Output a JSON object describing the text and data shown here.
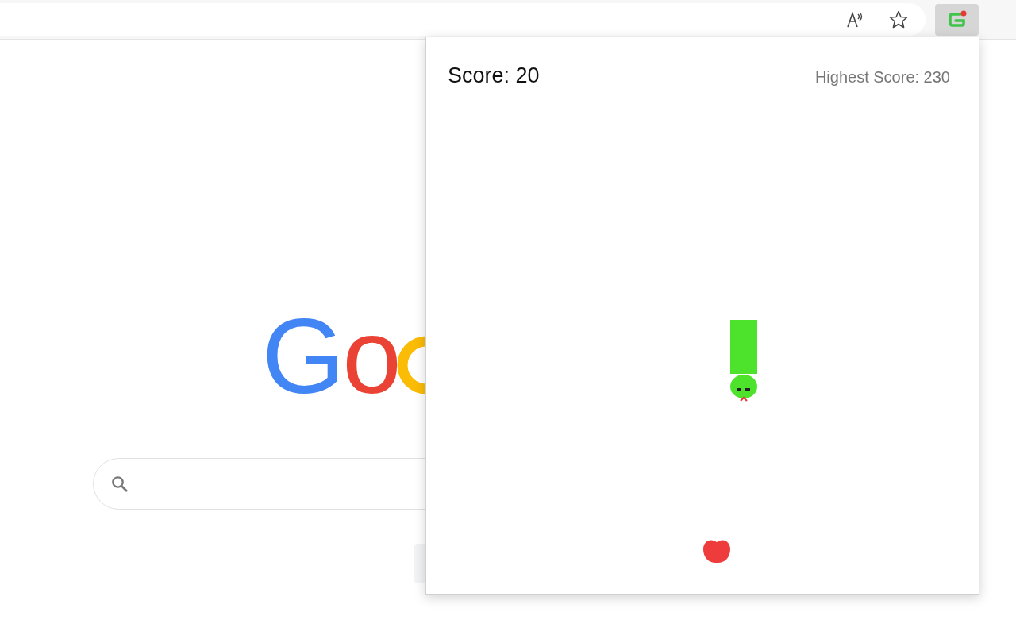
{
  "page": {
    "logo_letters": [
      {
        "text": "G",
        "color": "#4285f4"
      },
      {
        "text": "o",
        "color": "#ea4335"
      }
    ]
  },
  "popup": {
    "score": "Score: 20",
    "highest_score": "Highest Score: 230"
  }
}
